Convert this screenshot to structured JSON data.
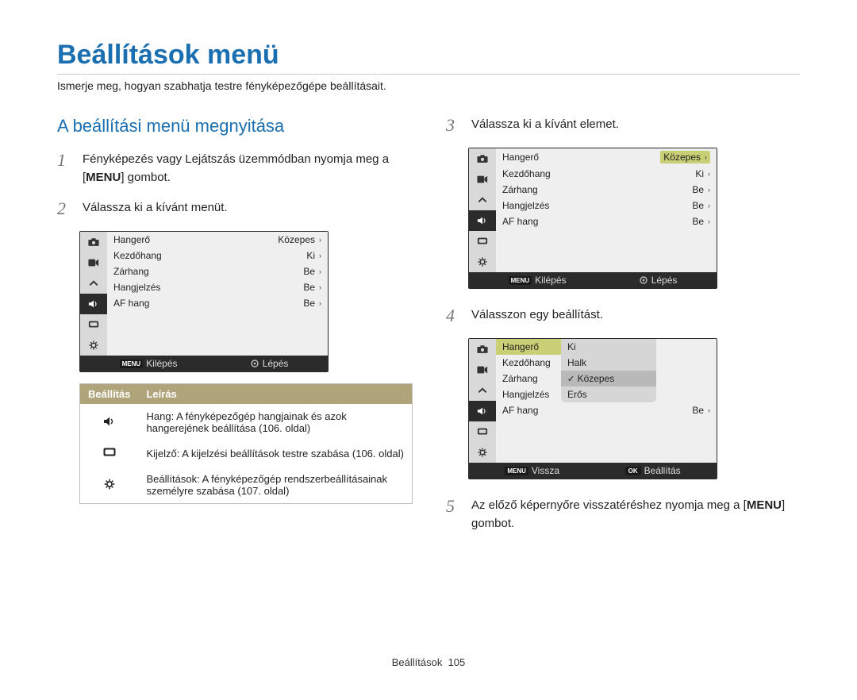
{
  "title": "Beállítások menü",
  "intro": "Ismerje meg, hogyan szabhatja testre fényképezőgépe beállításait.",
  "section_open": "A beállítási menü megnyitása",
  "steps": {
    "s1a": "Fényképezés vagy Lejátszás üzemmódban nyomja meg a",
    "s1b": "] gombot.",
    "menu_word": "MENU",
    "s2": "Válassza ki a kívánt menüt.",
    "s3": "Válassza ki a kívánt elemet.",
    "s4": "Válasszon egy beállítást.",
    "s5a": "Az előző képernyőre visszatéréshez nyomja meg a",
    "s5b": "] gombot."
  },
  "menu_items": {
    "r1": "Hangerő",
    "r2": "Kezdőhang",
    "r3": "Zárhang",
    "r4": "Hangjelzés",
    "r5": "AF hang",
    "v_kozepes": "Közepes",
    "v_ki": "Ki",
    "v_be": "Be"
  },
  "footbar": {
    "exit": "Kilépés",
    "move": "Lépés",
    "back": "Vissza",
    "set": "Beállítás",
    "menu_tag": "MENU",
    "ok_tag": "OK"
  },
  "def_table": {
    "h1": "Beállítás",
    "h2": "Leírás",
    "d1": "Hang: A fényképezőgép hangjainak és azok hangerejének beállítása (106. oldal)",
    "d2": "Kijelző: A kijelzési beállítások testre szabása (106. oldal)",
    "d3": "Beállítások: A fényképezőgép rendszerbeállításainak személyre szabása (107. oldal)"
  },
  "dropdown": {
    "o1": "Ki",
    "o2": "Halk",
    "o3": "Közepes",
    "o4": "Erős"
  },
  "page_footer_label": "Beállítások",
  "page_footer_num": "105"
}
